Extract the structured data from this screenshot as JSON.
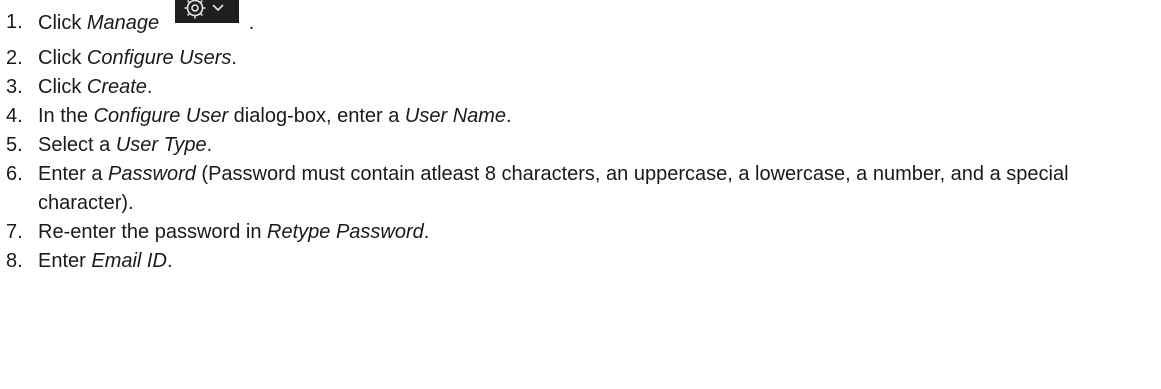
{
  "steps": [
    {
      "num": "1.",
      "text_a": "Click ",
      "em_a": "Manage",
      "text_b": " ."
    },
    {
      "num": "2.",
      "text_a": "Click ",
      "em_a": "Configure Users",
      "text_b": "."
    },
    {
      "num": "3.",
      "text_a": "Click ",
      "em_a": "Create",
      "text_b": "."
    },
    {
      "num": "4.",
      "text_a": "In the ",
      "em_a": "Configure User",
      "text_b": " dialog-box, enter a ",
      "em_b": "User Name",
      "text_c": "."
    },
    {
      "num": "5.",
      "text_a": "Select a ",
      "em_a": "User Type",
      "text_b": "."
    },
    {
      "num": "6.",
      "text_a": "Enter a ",
      "em_a": "Password",
      "text_b": " (Password must contain atleast 8 characters, an uppercase, a lowercase, a number, and a special character)."
    },
    {
      "num": "7.",
      "text_a": "Re-enter the password in ",
      "em_a": "Retype Password",
      "text_b": "."
    },
    {
      "num": "8.",
      "text_a": "Enter ",
      "em_a": "Email ID",
      "text_b": "."
    }
  ],
  "icons": {
    "manage": "gear-chevron-down-icon"
  }
}
